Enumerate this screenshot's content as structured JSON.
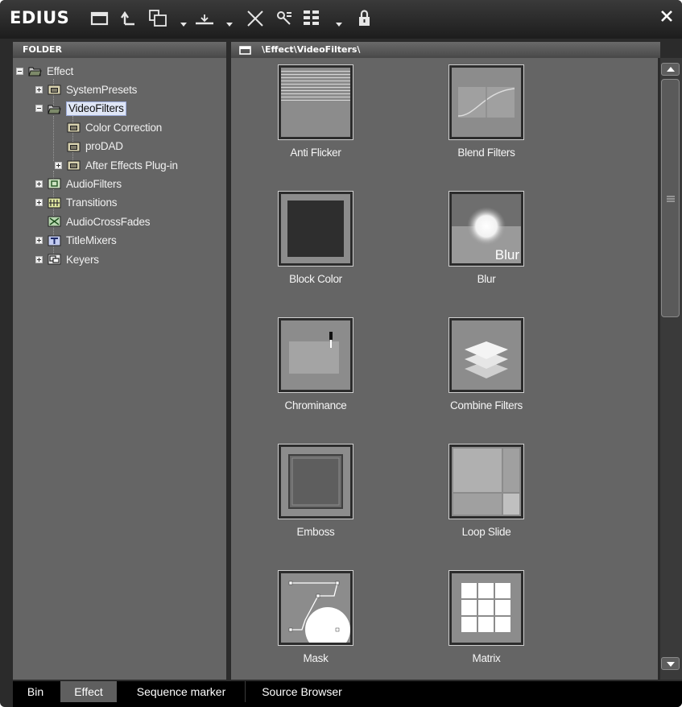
{
  "app": {
    "logo": "EDIUS"
  },
  "toolbar": {
    "icons": [
      "folder-icon",
      "up-folder-icon",
      "copy-icon",
      "dropdown-arrow-icon",
      "insert-icon",
      "dropdown-arrow-icon",
      "delete-icon",
      "properties-icon",
      "view-icon",
      "dropdown-arrow-icon",
      "lock-icon",
      "close-icon"
    ]
  },
  "folder_panel": {
    "header": "FOLDER",
    "tree": [
      {
        "label": "Effect",
        "expander": "minus",
        "icon": "folder-open-icon"
      },
      {
        "label": "SystemPresets",
        "expander": "plus",
        "icon": "presets-folder-icon"
      },
      {
        "label": "VideoFilters",
        "expander": "minus",
        "icon": "folder-open-icon",
        "selected": true
      },
      {
        "label": "Color Correction",
        "expander": "none",
        "icon": "presets-folder-icon"
      },
      {
        "label": "proDAD",
        "expander": "none",
        "icon": "presets-folder-icon"
      },
      {
        "label": "After Effects Plug-in",
        "expander": "plus",
        "icon": "presets-folder-icon"
      },
      {
        "label": "AudioFilters",
        "expander": "plus",
        "icon": "audio-filter-icon"
      },
      {
        "label": "Transitions",
        "expander": "plus",
        "icon": "transition-icon"
      },
      {
        "label": "AudioCrossFades",
        "expander": "none",
        "icon": "audio-crossfade-icon"
      },
      {
        "label": "TitleMixers",
        "expander": "plus",
        "icon": "title-mixer-icon"
      },
      {
        "label": "Keyers",
        "expander": "plus",
        "icon": "keyer-icon"
      }
    ]
  },
  "content_panel": {
    "path": "\\Effect\\VideoFilters\\",
    "items": [
      {
        "label": "Anti Flicker",
        "thumb": "anti-flicker"
      },
      {
        "label": "Blend Filters",
        "thumb": "blend-filters"
      },
      {
        "label": "Block Color",
        "thumb": "block-color"
      },
      {
        "label": "Blur",
        "thumb": "blur",
        "thumb_text": "Blur"
      },
      {
        "label": "Chrominance",
        "thumb": "chrominance"
      },
      {
        "label": "Combine Filters",
        "thumb": "combine-filters"
      },
      {
        "label": "Emboss",
        "thumb": "emboss"
      },
      {
        "label": "Loop Slide",
        "thumb": "loop-slide"
      },
      {
        "label": "Mask",
        "thumb": "mask"
      },
      {
        "label": "Matrix",
        "thumb": "matrix"
      }
    ]
  },
  "tabs": [
    {
      "label": "Bin",
      "active": false
    },
    {
      "label": "Effect",
      "active": true
    },
    {
      "label": "Sequence marker",
      "active": false
    },
    {
      "label": "Source Browser",
      "active": false
    }
  ],
  "colors": {
    "panel_bg": "#656565",
    "window_bg": "#2b2b2b",
    "selection_bg": "#dfe6f6"
  }
}
